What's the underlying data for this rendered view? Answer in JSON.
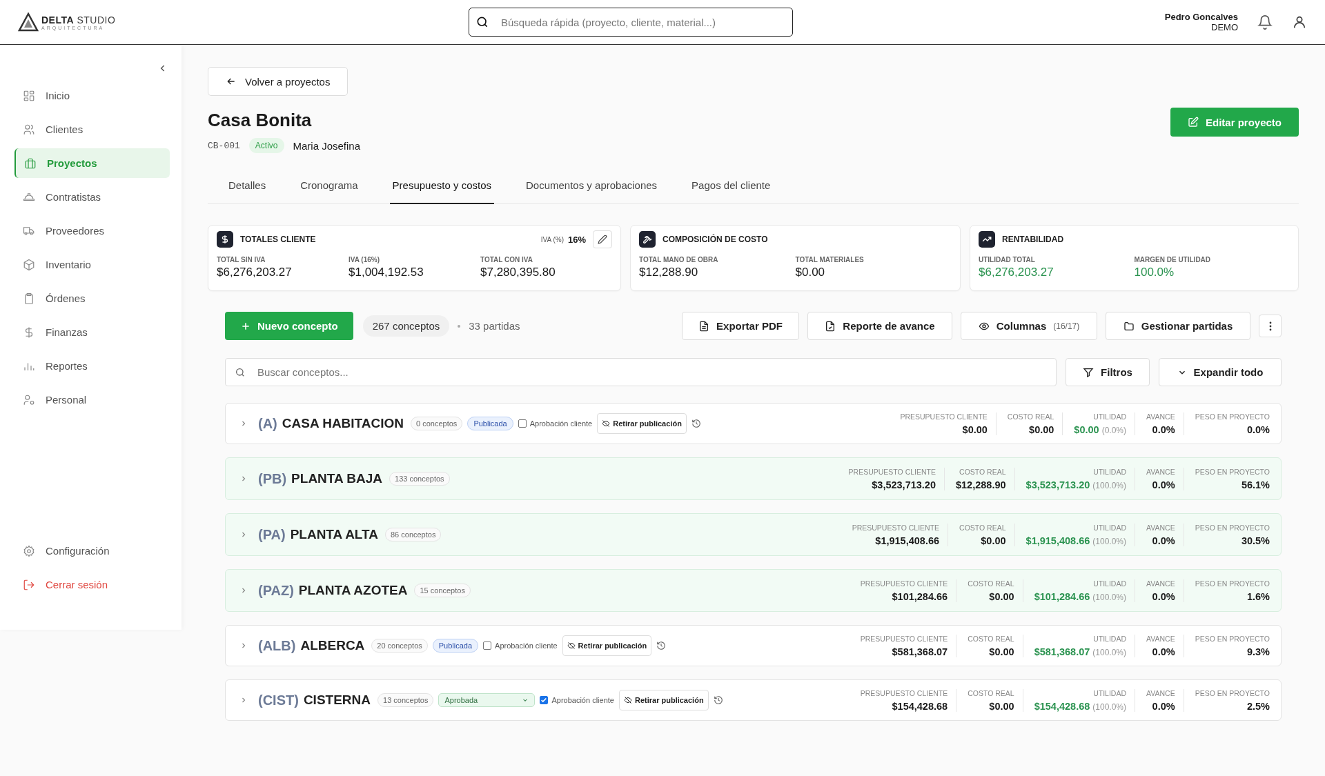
{
  "header": {
    "logo_main": "DELTA",
    "logo_light": "STUDIO",
    "logo_sub": "ARQUITECTURA",
    "search": {
      "placeholder": "Búsqueda rápida (proyecto, cliente, material...)"
    },
    "user_name": "Pedro Goncalves",
    "user_role": "DEMO"
  },
  "sidebar": {
    "items": [
      {
        "label": "Inicio",
        "selected": false
      },
      {
        "label": "Clientes",
        "selected": false
      },
      {
        "label": "Proyectos",
        "selected": true
      },
      {
        "label": "Contratistas",
        "selected": false
      },
      {
        "label": "Proveedores",
        "selected": false
      },
      {
        "label": "Inventario",
        "selected": false
      },
      {
        "label": "Órdenes",
        "selected": false
      },
      {
        "label": "Finanzas",
        "selected": false
      },
      {
        "label": "Reportes",
        "selected": false
      },
      {
        "label": "Personal",
        "selected": false
      }
    ],
    "bottom": [
      {
        "label": "Configuración",
        "kind": "normal"
      },
      {
        "label": "Cerrar sesión",
        "kind": "danger"
      }
    ]
  },
  "back_button": "Volver a proyectos",
  "project": {
    "title": "Casa Bonita",
    "code": "CB-001",
    "status": "Activo",
    "client": "Maria Josefina",
    "edit_button": "Editar proyecto"
  },
  "tabs": [
    {
      "label": "Detalles",
      "selected": false
    },
    {
      "label": "Cronograma",
      "selected": false
    },
    {
      "label": "Presupuesto y costos",
      "selected": true
    },
    {
      "label": "Documentos y aprobaciones",
      "selected": false
    },
    {
      "label": "Pagos del cliente",
      "selected": false
    }
  ],
  "cards": [
    {
      "title": "TOTALES CLIENTE",
      "iva_label": "IVA (%)",
      "iva_value": "16%",
      "metrics": [
        {
          "label": "TOTAL SIN IVA",
          "value": "$6,276,203.27",
          "kind": "plain"
        },
        {
          "label": "IVA (16%)",
          "value": "$1,004,192.53",
          "kind": "plain"
        },
        {
          "label": "TOTAL CON IVA",
          "value": "$7,280,395.80",
          "kind": "plain"
        }
      ]
    },
    {
      "title": "COMPOSICIÓN DE COSTO",
      "metrics": [
        {
          "label": "TOTAL MANO DE OBRA",
          "value": "$12,288.90",
          "kind": "plain"
        },
        {
          "label": "TOTAL MATERIALES",
          "value": "$0.00",
          "kind": "plain"
        }
      ]
    },
    {
      "title": "RENTABILIDAD",
      "metrics": [
        {
          "label": "UTILIDAD TOTAL",
          "value": "$6,276,203.27",
          "kind": "profit"
        },
        {
          "label": "MARGEN DE UTILIDAD",
          "value": "100.0%",
          "kind": "profit"
        }
      ]
    }
  ],
  "toolbar": {
    "new_button": "Nuevo concepto",
    "concept_count": "267 conceptos",
    "partida_count": "33 partidas",
    "export_button": "Exportar PDF",
    "report_button": "Reporte de avance",
    "columns_button": "Columnas",
    "columns_count": "(16/17)",
    "manage_button": "Gestionar partidas"
  },
  "concept_search": {
    "placeholder": "Buscar conceptos..."
  },
  "filters_button": "Filtros",
  "expand_button": "Expandir todo",
  "groups": [
    {
      "code": "(A)",
      "name": "CASA HABITACION",
      "count": "0 conceptos",
      "highlighted": false,
      "status": {
        "kind": "badge",
        "label": "Publicada"
      },
      "approval": {
        "label": "Aprobación cliente",
        "checked": false
      },
      "withdraw_button": "Retirar publicación",
      "metrics": [
        {
          "label": "PRESUPUESTO CLIENTE",
          "value": "$0.00",
          "kind": "plain"
        },
        {
          "label": "COSTO REAL",
          "value": "$0.00",
          "kind": "plain"
        },
        {
          "label": "UTILIDAD",
          "value": "$0.00",
          "note": "(0.0%)",
          "kind": "profit"
        },
        {
          "label": "AVANCE",
          "value": "0.0%",
          "kind": "plain"
        },
        {
          "label": "PESO EN PROYECTO",
          "value": "0.0%",
          "kind": "plain"
        }
      ]
    },
    {
      "code": "(PB)",
      "name": "PLANTA BAJA",
      "count": "133 conceptos",
      "highlighted": true,
      "metrics": [
        {
          "label": "PRESUPUESTO CLIENTE",
          "value": "$3,523,713.20",
          "kind": "plain"
        },
        {
          "label": "COSTO REAL",
          "value": "$12,288.90",
          "kind": "plain"
        },
        {
          "label": "UTILIDAD",
          "value": "$3,523,713.20",
          "note": "(100.0%)",
          "kind": "profit"
        },
        {
          "label": "AVANCE",
          "value": "0.0%",
          "kind": "plain"
        },
        {
          "label": "PESO EN PROYECTO",
          "value": "56.1%",
          "kind": "plain"
        }
      ]
    },
    {
      "code": "(PA)",
      "name": "PLANTA ALTA",
      "count": "86 conceptos",
      "highlighted": true,
      "metrics": [
        {
          "label": "PRESUPUESTO CLIENTE",
          "value": "$1,915,408.66",
          "kind": "plain"
        },
        {
          "label": "COSTO REAL",
          "value": "$0.00",
          "kind": "plain"
        },
        {
          "label": "UTILIDAD",
          "value": "$1,915,408.66",
          "note": "(100.0%)",
          "kind": "profit"
        },
        {
          "label": "AVANCE",
          "value": "0.0%",
          "kind": "plain"
        },
        {
          "label": "PESO EN PROYECTO",
          "value": "30.5%",
          "kind": "plain"
        }
      ]
    },
    {
      "code": "(PAZ)",
      "name": "PLANTA AZOTEA",
      "count": "15 conceptos",
      "highlighted": true,
      "metrics": [
        {
          "label": "PRESUPUESTO CLIENTE",
          "value": "$101,284.66",
          "kind": "plain"
        },
        {
          "label": "COSTO REAL",
          "value": "$0.00",
          "kind": "plain"
        },
        {
          "label": "UTILIDAD",
          "value": "$101,284.66",
          "note": "(100.0%)",
          "kind": "profit"
        },
        {
          "label": "AVANCE",
          "value": "0.0%",
          "kind": "plain"
        },
        {
          "label": "PESO EN PROYECTO",
          "value": "1.6%",
          "kind": "plain"
        }
      ]
    },
    {
      "code": "(ALB)",
      "name": "ALBERCA",
      "count": "20 conceptos",
      "highlighted": false,
      "status": {
        "kind": "badge",
        "label": "Publicada"
      },
      "approval": {
        "label": "Aprobación cliente",
        "checked": false
      },
      "withdraw_button": "Retirar publicación",
      "metrics": [
        {
          "label": "PRESUPUESTO CLIENTE",
          "value": "$581,368.07",
          "kind": "plain"
        },
        {
          "label": "COSTO REAL",
          "value": "$0.00",
          "kind": "plain"
        },
        {
          "label": "UTILIDAD",
          "value": "$581,368.07",
          "note": "(100.0%)",
          "kind": "profit"
        },
        {
          "label": "AVANCE",
          "value": "0.0%",
          "kind": "plain"
        },
        {
          "label": "PESO EN PROYECTO",
          "value": "9.3%",
          "kind": "plain"
        }
      ]
    },
    {
      "code": "(CIST)",
      "name": "CISTERNA",
      "count": "13 conceptos",
      "highlighted": false,
      "status": {
        "kind": "select",
        "label": "Aprobada"
      },
      "approval": {
        "label": "Aprobación cliente",
        "checked": true
      },
      "withdraw_button": "Retirar publicación",
      "metrics": [
        {
          "label": "PRESUPUESTO CLIENTE",
          "value": "$154,428.68",
          "kind": "plain"
        },
        {
          "label": "COSTO REAL",
          "value": "$0.00",
          "kind": "plain"
        },
        {
          "label": "UTILIDAD",
          "value": "$154,428.68",
          "note": "(100.0%)",
          "kind": "profit"
        },
        {
          "label": "AVANCE",
          "value": "0.0%",
          "kind": "plain"
        },
        {
          "label": "PESO EN PROYECTO",
          "value": "2.5%",
          "kind": "plain"
        }
      ]
    }
  ]
}
